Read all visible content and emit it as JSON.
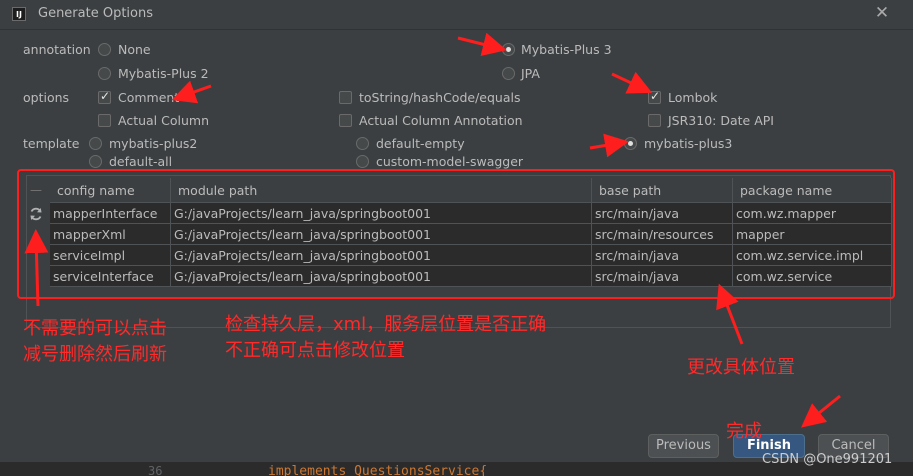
{
  "window": {
    "title": "Generate Options",
    "app_icon": "IJ"
  },
  "annotation": {
    "label": "annotation",
    "options": [
      "None",
      "Mybatis-Plus 2",
      "Mybatis-Plus 3",
      "JPA"
    ],
    "selected": "Mybatis-Plus 3"
  },
  "options": {
    "label": "options",
    "items": [
      {
        "label": "Comment",
        "checked": true
      },
      {
        "label": "Actual Column",
        "checked": false
      },
      {
        "label": "toString/hashCode/equals",
        "checked": false
      },
      {
        "label": "Actual Column Annotation",
        "checked": false
      },
      {
        "label": "Lombok",
        "checked": true
      },
      {
        "label": "JSR310: Date API",
        "checked": false
      }
    ]
  },
  "template": {
    "label": "template",
    "options": [
      "mybatis-plus2",
      "default-all",
      "default-empty",
      "custom-model-swagger",
      "mybatis-plus3"
    ],
    "selected": "mybatis-plus3"
  },
  "table": {
    "remove_glyph": "—",
    "refresh_icon": "refresh-icon",
    "headers": [
      "config name",
      "module path",
      "base path",
      "package name"
    ],
    "rows": [
      [
        "mapperInterface",
        "G:/javaProjects/learn_java/springboot001",
        "src/main/java",
        "com.wz.mapper"
      ],
      [
        "mapperXml",
        "G:/javaProjects/learn_java/springboot001",
        "src/main/resources",
        "mapper"
      ],
      [
        "serviceImpl",
        "G:/javaProjects/learn_java/springboot001",
        "src/main/java",
        "com.wz.service.impl"
      ],
      [
        "serviceInterface",
        "G:/javaProjects/learn_java/springboot001",
        "src/main/java",
        "com.wz.service"
      ]
    ]
  },
  "annotations": {
    "note_remove_1": "不需要的可以点击",
    "note_remove_2": "减号删除然后刷新",
    "note_check_1": "检查持久层，xml，服务层位置是否正确",
    "note_check_2": "不正确可点击修改位置",
    "note_change": "更改具体位置",
    "note_done": "完成",
    "color": "#ff1e1e"
  },
  "buttons": {
    "previous": "Previous",
    "finish": "Finish",
    "cancel": "Cancel"
  },
  "code_line": {
    "number": "36",
    "text": "implements QuestionsService{"
  },
  "watermark": "CSDN @One991201"
}
